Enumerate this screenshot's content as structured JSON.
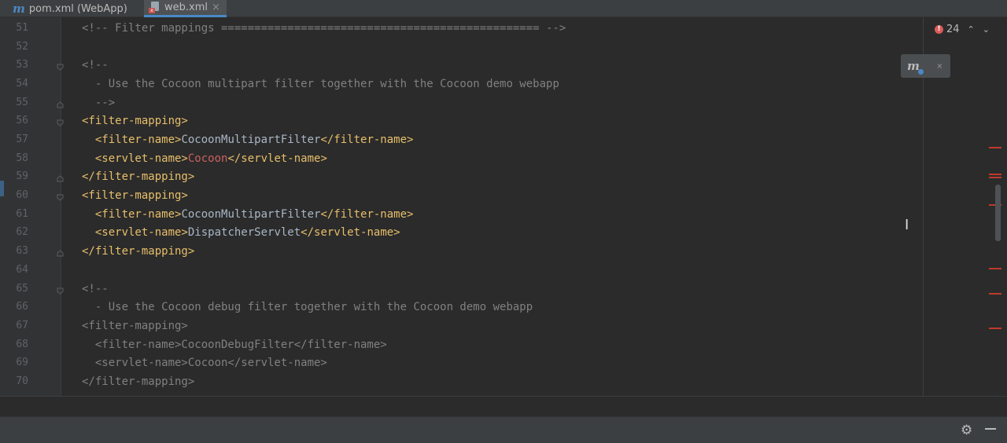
{
  "tabs": [
    {
      "label": "pom.xml (WebApp)",
      "icon": "maven-icon",
      "active": false
    },
    {
      "label": "web.xml",
      "icon": "xml-file-icon",
      "active": true,
      "close": "×"
    }
  ],
  "editor": {
    "lines": [
      {
        "num": "51",
        "text": "<!-- Filter mappings ================================================ -->"
      },
      {
        "num": "52",
        "text": ""
      },
      {
        "num": "53",
        "text": "<!--"
      },
      {
        "num": "54",
        "text": "  - Use the Cocoon multipart filter together with the Cocoon demo webapp"
      },
      {
        "num": "55",
        "text": "  -->"
      },
      {
        "num": "56",
        "text": "<filter-mapping>"
      },
      {
        "num": "57",
        "text": "  <filter-name>CocoonMultipartFilter</filter-name>"
      },
      {
        "num": "58",
        "text": "  <servlet-name>Cocoon</servlet-name>"
      },
      {
        "num": "59",
        "text": "</filter-mapping>"
      },
      {
        "num": "60",
        "text": "<filter-mapping>"
      },
      {
        "num": "61",
        "text": "  <filter-name>CocoonMultipartFilter</filter-name>"
      },
      {
        "num": "62",
        "text": "  <servlet-name>DispatcherServlet</servlet-name>"
      },
      {
        "num": "63",
        "text": "</filter-mapping>"
      },
      {
        "num": "64",
        "text": ""
      },
      {
        "num": "65",
        "text": "<!--"
      },
      {
        "num": "66",
        "text": "  - Use the Cocoon debug filter together with the Cocoon demo webapp"
      },
      {
        "num": "67",
        "text": "<filter-mapping>"
      },
      {
        "num": "68",
        "text": "  <filter-name>CocoonDebugFilter</filter-name>"
      },
      {
        "num": "69",
        "text": "  <servlet-name>Cocoon</servlet-name>"
      },
      {
        "num": "70",
        "text": "</filter-mapping>"
      }
    ]
  },
  "inspections": {
    "error_count": "24",
    "up_arrow": "⌃",
    "down_arrow": "⌄"
  },
  "maven_popup": {
    "icon": "maven-reload-icon",
    "close": "×"
  },
  "status": {
    "settings_icon": "gear-icon",
    "hide_icon": "minimize-icon"
  },
  "colors": {
    "tag": "#e8bf6a",
    "comment": "#808080",
    "text": "#a9b7c6",
    "unresolved": "#cc6060",
    "error": "#db5c5c",
    "accent": "#4a88c7"
  }
}
